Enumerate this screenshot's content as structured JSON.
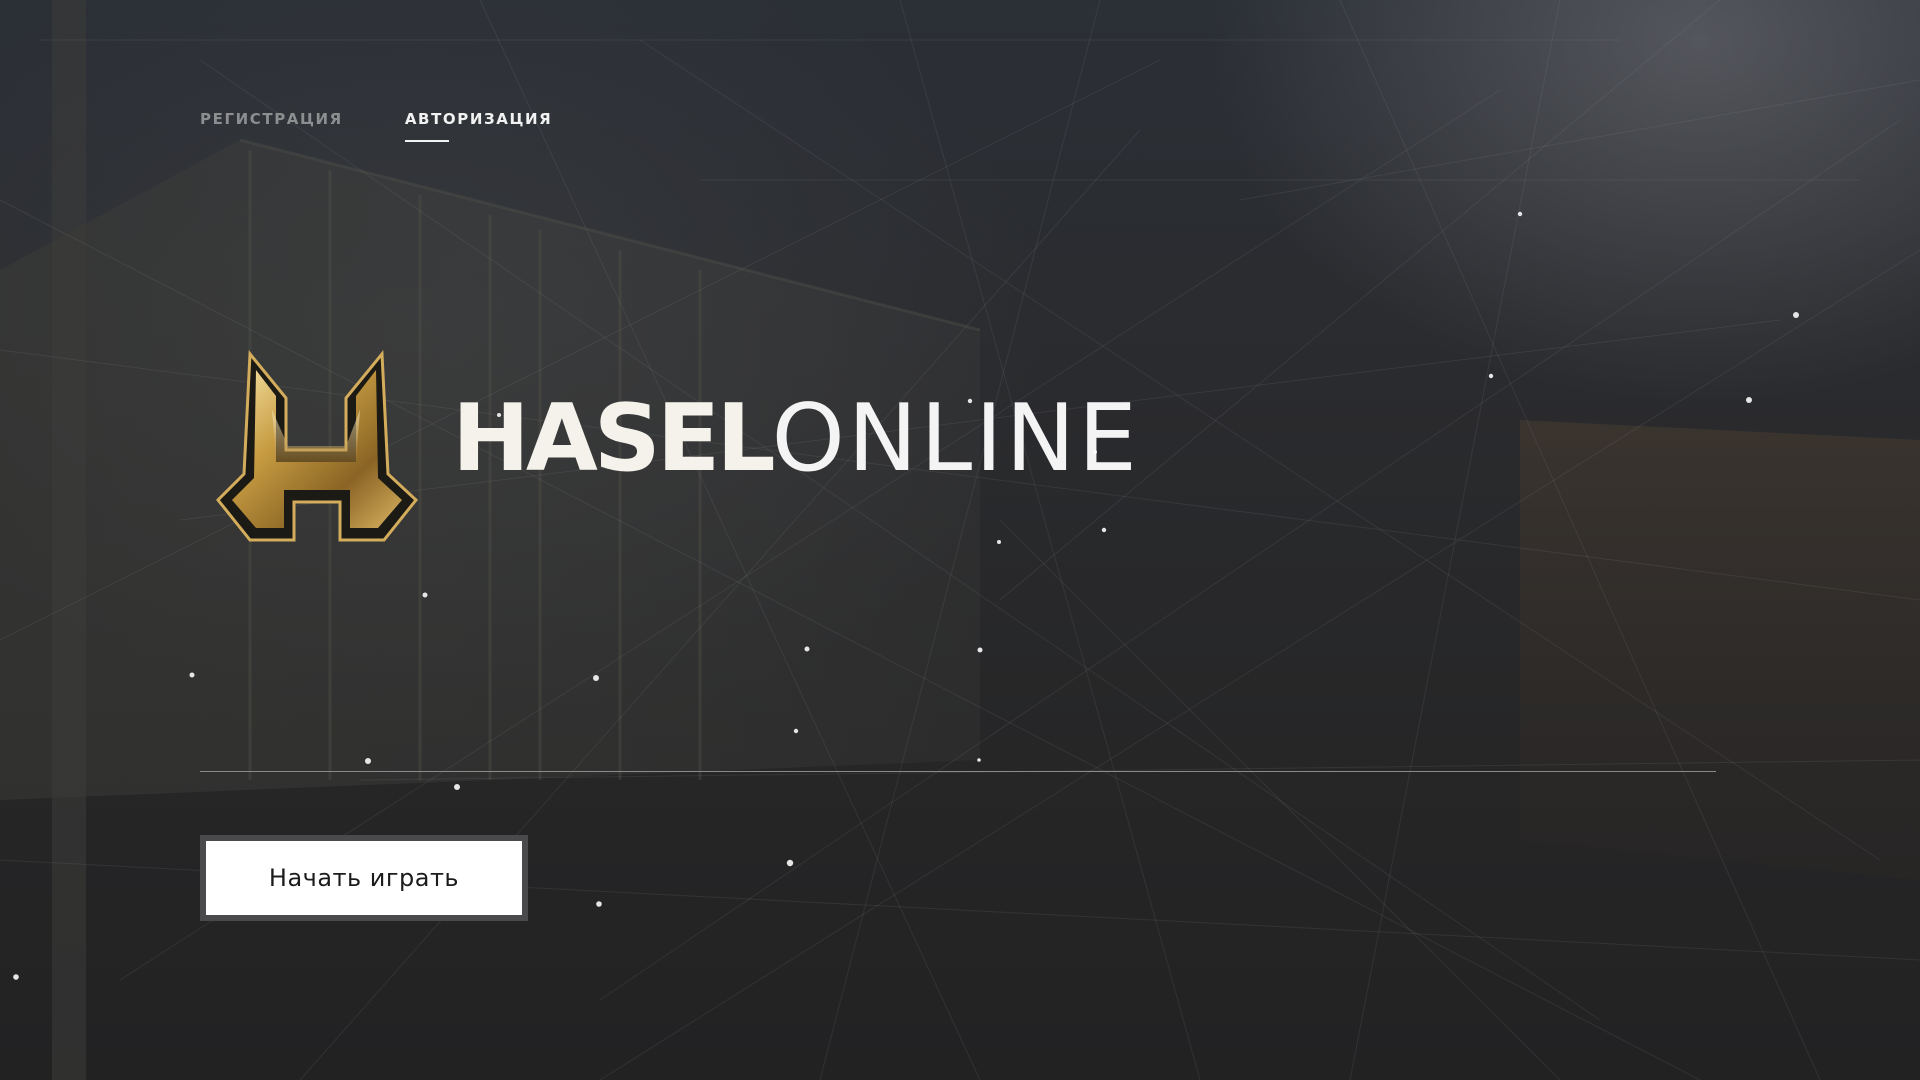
{
  "tabs": {
    "register_label": "РЕГИСТРАЦИЯ",
    "login_label": "АВТОРИЗАЦИЯ",
    "active": "login"
  },
  "brand": {
    "name_bold": "HASEL",
    "name_light": "ONLINE",
    "logo_icon": "hasel-h-emblem-icon"
  },
  "actions": {
    "play_label": "Начать играть"
  },
  "colors": {
    "background": "#232426",
    "text_primary": "#f4f2ea",
    "text_muted": "#8d8e90",
    "logo_gold": "#c9a24a",
    "button_bg": "#ffffff",
    "button_border": "#4a4a4c"
  }
}
